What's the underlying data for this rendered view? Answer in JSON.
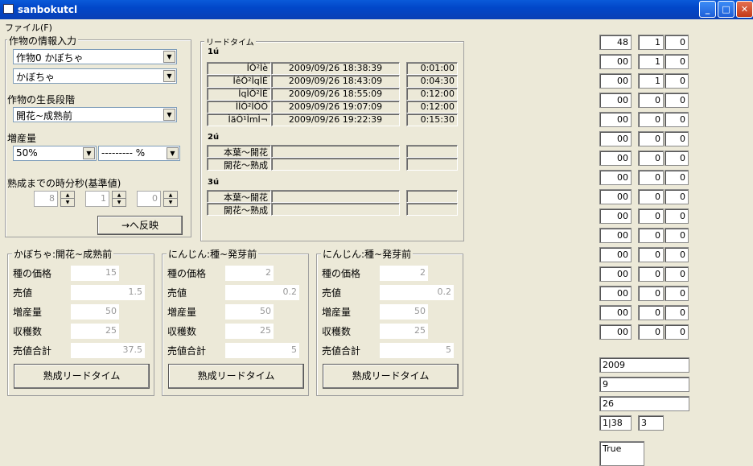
{
  "window": {
    "title": "sanbokutcl"
  },
  "menu": {
    "file": "ファイル(F)"
  },
  "input_group": {
    "title": "作物の情報入力",
    "crop_combo": "作物0 かぼちゃ",
    "variety_combo": "かぼちゃ",
    "stage_label": "作物の生長段階",
    "stage_combo": "開花~成熟前",
    "increase_label": "増産量",
    "increase_combo": "50%",
    "increase_combo2": "--------- %",
    "mature_label": "熟成までの時分秒(基準値)",
    "spin_h": "8",
    "spin_m": "1",
    "spin_s": "0",
    "apply_button": "→へ反映"
  },
  "lead_group": {
    "title": "リードタイム",
    "sec1": {
      "label": "1ú",
      "rows": [
        {
          "name": "ÍÔ²Ìè",
          "date": "2009/09/26 18:38:39",
          "dur": "0:01:00"
        },
        {
          "name": "ÍêÔ²ÌqÌÈ",
          "date": "2009/09/26 18:43:09",
          "dur": "0:04:30"
        },
        {
          "name": "ÍqÌÔ²ÌÈ",
          "date": "2009/09/26 18:55:09",
          "dur": "0:12:00"
        },
        {
          "name": "ÌÍÔ²ÌÔÖ",
          "date": "2009/09/26 19:07:09",
          "dur": "0:12:00"
        },
        {
          "name": "ÌäÔ¹ÌmÌ¬",
          "date": "2009/09/26 19:22:39",
          "dur": "0:15:30"
        }
      ]
    },
    "sec2": {
      "label": "2ú",
      "rows": [
        {
          "name": "本葉～開花",
          "date": "",
          "dur": ""
        },
        {
          "name": "開花～熟成",
          "date": "",
          "dur": ""
        }
      ]
    },
    "sec3": {
      "label": "3ú",
      "rows": [
        {
          "name": "本葉～開花",
          "date": "",
          "dur": ""
        },
        {
          "name": "開花～熟成",
          "date": "",
          "dur": ""
        }
      ]
    }
  },
  "crop_panels": [
    {
      "title": "かぼちゃ:開花~成熟前",
      "seed_label": "種の価格",
      "seed": "15",
      "price_label": "売値",
      "price": "1.5",
      "inc_label": "増産量",
      "inc": "50",
      "harvest_label": "収穫数",
      "harvest": "25",
      "total_label": "売値合計",
      "total": "37.5",
      "button": "熟成リードタイム"
    },
    {
      "title": "にんじん:種~発芽前",
      "seed_label": "種の価格",
      "seed": "2",
      "price_label": "売値",
      "price": "0.2",
      "inc_label": "増産量",
      "inc": "50",
      "harvest_label": "収穫数",
      "harvest": "25",
      "total_label": "売値合計",
      "total": "5",
      "button": "熟成リードタイム"
    },
    {
      "title": "にんじん:種~発芽前",
      "seed_label": "種の価格",
      "seed": "2",
      "price_label": "売値",
      "price": "0.2",
      "inc_label": "増産量",
      "inc": "50",
      "harvest_label": "収穫数",
      "harvest": "25",
      "total_label": "売値合計",
      "total": "5",
      "button": "熟成リードタイム"
    }
  ],
  "right_grid": [
    [
      "48",
      "1",
      "0"
    ],
    [
      "00",
      "1",
      "0"
    ],
    [
      "00",
      "1",
      "0"
    ],
    [
      "00",
      "0",
      "0"
    ],
    [
      "00",
      "0",
      "0"
    ],
    [
      "00",
      "0",
      "0"
    ],
    [
      "00",
      "0",
      "0"
    ],
    [
      "00",
      "0",
      "0"
    ],
    [
      "00",
      "0",
      "0"
    ],
    [
      "00",
      "0",
      "0"
    ],
    [
      "00",
      "0",
      "0"
    ],
    [
      "00",
      "0",
      "0"
    ],
    [
      "00",
      "0",
      "0"
    ],
    [
      "00",
      "0",
      "0"
    ],
    [
      "00",
      "0",
      "0"
    ],
    [
      "00",
      "0",
      "0"
    ]
  ],
  "right_fields": {
    "year": "2009",
    "month": "9",
    "day": "26",
    "val1": "1|38",
    "val2": "3",
    "bool": "True"
  }
}
